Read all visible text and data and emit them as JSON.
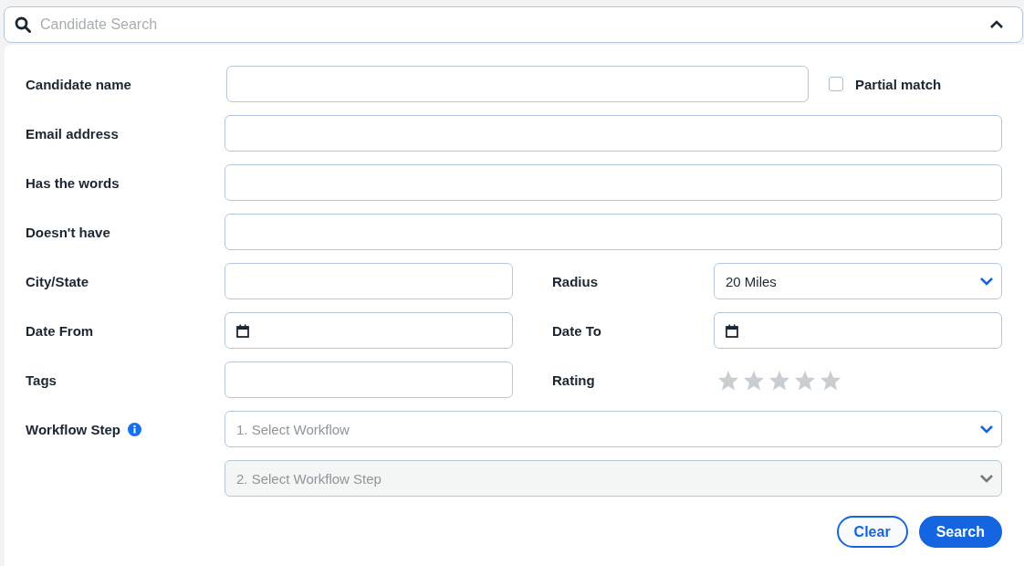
{
  "search_bar": {
    "placeholder": "Candidate Search",
    "expanded": true
  },
  "rows": [
    {
      "kind": "text_check",
      "label": "Candidate name",
      "checkbox": {
        "label": "Partial match",
        "checked": false
      }
    },
    {
      "kind": "text",
      "label": "Email address"
    },
    {
      "kind": "text",
      "label": "Has the words"
    },
    {
      "kind": "text",
      "label": "Doesn't have"
    },
    {
      "kind": "pair",
      "left": {
        "kind": "text",
        "label": "City/State"
      },
      "right": {
        "kind": "select",
        "label": "Radius",
        "value": "20 Miles"
      }
    },
    {
      "kind": "pair",
      "left": {
        "kind": "date",
        "label": "Date From"
      },
      "right": {
        "kind": "date",
        "label": "Date To"
      }
    },
    {
      "kind": "pair",
      "left": {
        "kind": "text",
        "label": "Tags"
      },
      "right": {
        "kind": "rating",
        "label": "Rating",
        "stars": 0
      }
    },
    {
      "kind": "workflow",
      "label": "Workflow Step",
      "selects": [
        {
          "placeholder": "1. Select Workflow",
          "disabled": false
        },
        {
          "placeholder": "2. Select Workflow Step",
          "disabled": true
        }
      ]
    }
  ],
  "buttons": [
    {
      "label": "Clear",
      "kind": "secondary"
    },
    {
      "label": "Search",
      "kind": "primary"
    }
  ]
}
